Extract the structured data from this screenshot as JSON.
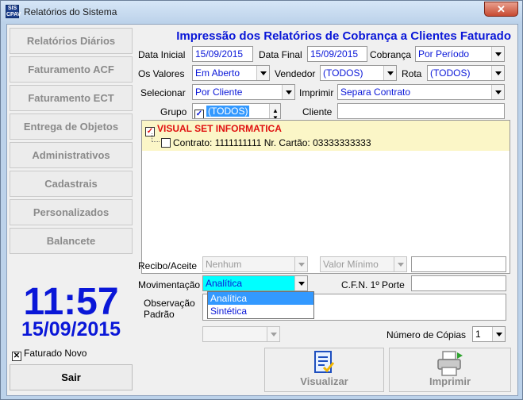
{
  "window": {
    "title": "Relatórios do Sistema",
    "app_icon_text": "SIS CPAV",
    "close_glyph": "✕"
  },
  "sidebar": {
    "items": [
      {
        "label": "Relatórios Diários"
      },
      {
        "label": "Faturamento ACF"
      },
      {
        "label": "Faturamento ECT"
      },
      {
        "label": "Entrega de Objetos"
      },
      {
        "label": "Administrativos"
      },
      {
        "label": "Cadastrais"
      },
      {
        "label": "Personalizados"
      },
      {
        "label": "Balancete"
      }
    ],
    "clock": "11:57",
    "date": "15/09/2015",
    "faturado_novo_label": "Faturado Novo",
    "faturado_novo_checked": true,
    "sair_label": "Sair"
  },
  "form": {
    "heading": "Impressão dos Relatórios de Cobrança a Clientes Faturado",
    "data_inicial_label": "Data Inicial",
    "data_inicial": "15/09/2015",
    "data_final_label": "Data Final",
    "data_final": "15/09/2015",
    "cobranca_label": "Cobrança",
    "cobranca": "Por Período",
    "os_valores_label": "Os Valores",
    "os_valores": "Em Aberto",
    "vendedor_label": "Vendedor",
    "vendedor": "(TODOS)",
    "rota_label": "Rota",
    "rota": "(TODOS)",
    "selecionar_label": "Selecionar",
    "selecionar": "Por Cliente",
    "imprimir_label": "Imprimir",
    "imprimir": "Separa Contrato",
    "grupo_label": "Grupo",
    "grupo": "(TODOS)",
    "cliente_label": "Cliente",
    "cliente": "",
    "tree": {
      "root": "VISUAL SET INFORMATICA",
      "child": "Contrato:  1111111111 Nr. Cartão: 03333333333"
    },
    "recibo_label": "Recibo/Aceite",
    "recibo": "Nenhum",
    "valor_minimo_placeholder": "Valor Mínimo",
    "valor_minimo": "",
    "movimentacao_label": "Movimentação",
    "movimentacao": "Analítica",
    "movimentacao_options": [
      "Analítica",
      "Sintética"
    ],
    "cfn_label": "C.F.N. 1º Porte",
    "cfn": "",
    "observacao_label": "Observação",
    "padrao_label": "Padrão",
    "observacao": "",
    "numero_copias_label": "Número de Cópias",
    "numero_copias": "1",
    "visualizar_label": "Visualizar",
    "imprimir_btn_label": "Imprimir"
  },
  "colors": {
    "accent_blue": "#0a17d8",
    "tree_red": "#e01010",
    "tree_band": "#fbf6c7",
    "highlight": "#3399ff",
    "cyan_select": "#00ffff"
  }
}
